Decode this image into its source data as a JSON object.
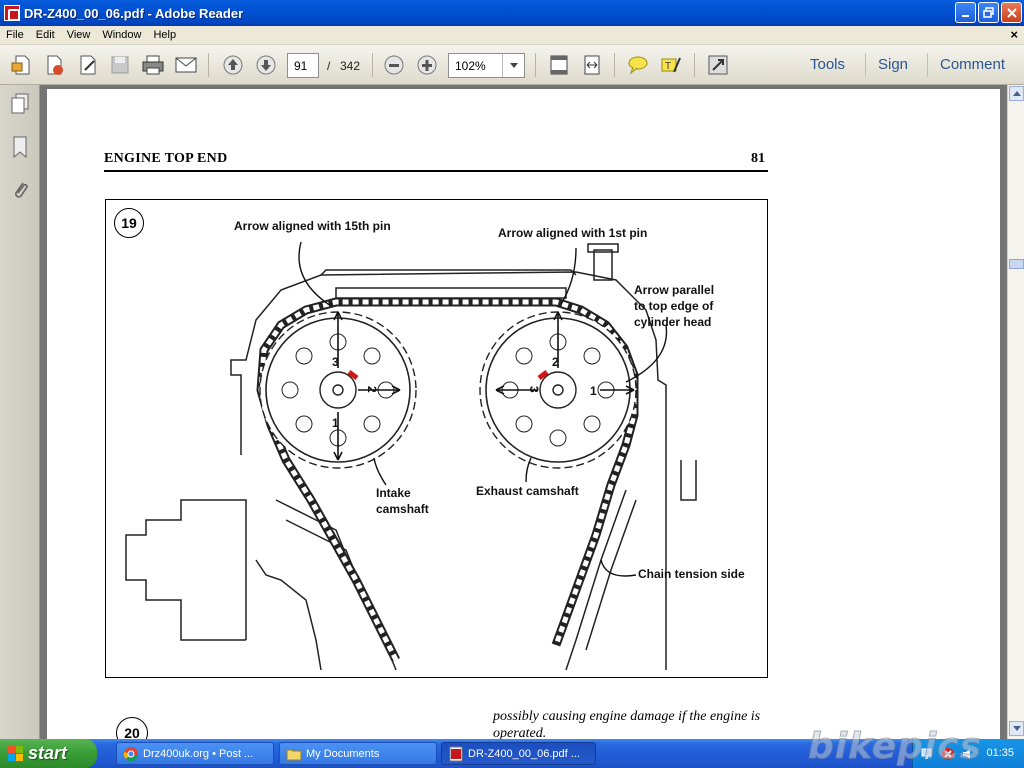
{
  "window": {
    "title": "DR-Z400_00_06.pdf - Adobe Reader",
    "minimize_icon": "minimize-icon",
    "maximize_icon": "restore-icon",
    "close_icon": "close-icon"
  },
  "menu": {
    "items": [
      "File",
      "Edit",
      "View",
      "Window",
      "Help"
    ],
    "close_glyph": "×"
  },
  "toolbar": {
    "current_page": "91",
    "page_separator": "/",
    "total_pages": "342",
    "zoom": "102%",
    "panels": [
      "Tools",
      "Sign",
      "Comment"
    ]
  },
  "document": {
    "header_title": "ENGINE TOP END",
    "page_number": "81",
    "figure_number": "19",
    "next_figure_number": "20",
    "labels": {
      "arrow_15th": "Arrow aligned with 15th pin",
      "arrow_1st": "Arrow aligned with 1st pin",
      "arrow_parallel_1": "Arrow parallel",
      "arrow_parallel_2": "to top edge of",
      "arrow_parallel_3": "cylinder head",
      "intake_1": "Intake",
      "intake_2": "camshaft",
      "exhaust": "Exhaust camshaft",
      "tension": "Chain tension side",
      "n1": "1",
      "n2": "2",
      "n3": "3"
    },
    "body_text": "possibly causing engine damage if the engine is operated."
  },
  "taskbar": {
    "start_label": "start",
    "tasks": [
      {
        "label": "Drz400uk.org • Post ...",
        "icon": "chrome-icon"
      },
      {
        "label": "My Documents",
        "icon": "folder-icon"
      },
      {
        "label": "DR-Z400_00_06.pdf ...",
        "icon": "pdf-icon"
      }
    ],
    "clock": "01:35"
  },
  "watermark": "bikepics",
  "colors": {
    "titlebar": "#0050d0",
    "taskbar": "#225ed8",
    "start": "#389c35",
    "link": "#2b5590",
    "doc_background": "#747474",
    "timing_mark": "#d01818"
  }
}
